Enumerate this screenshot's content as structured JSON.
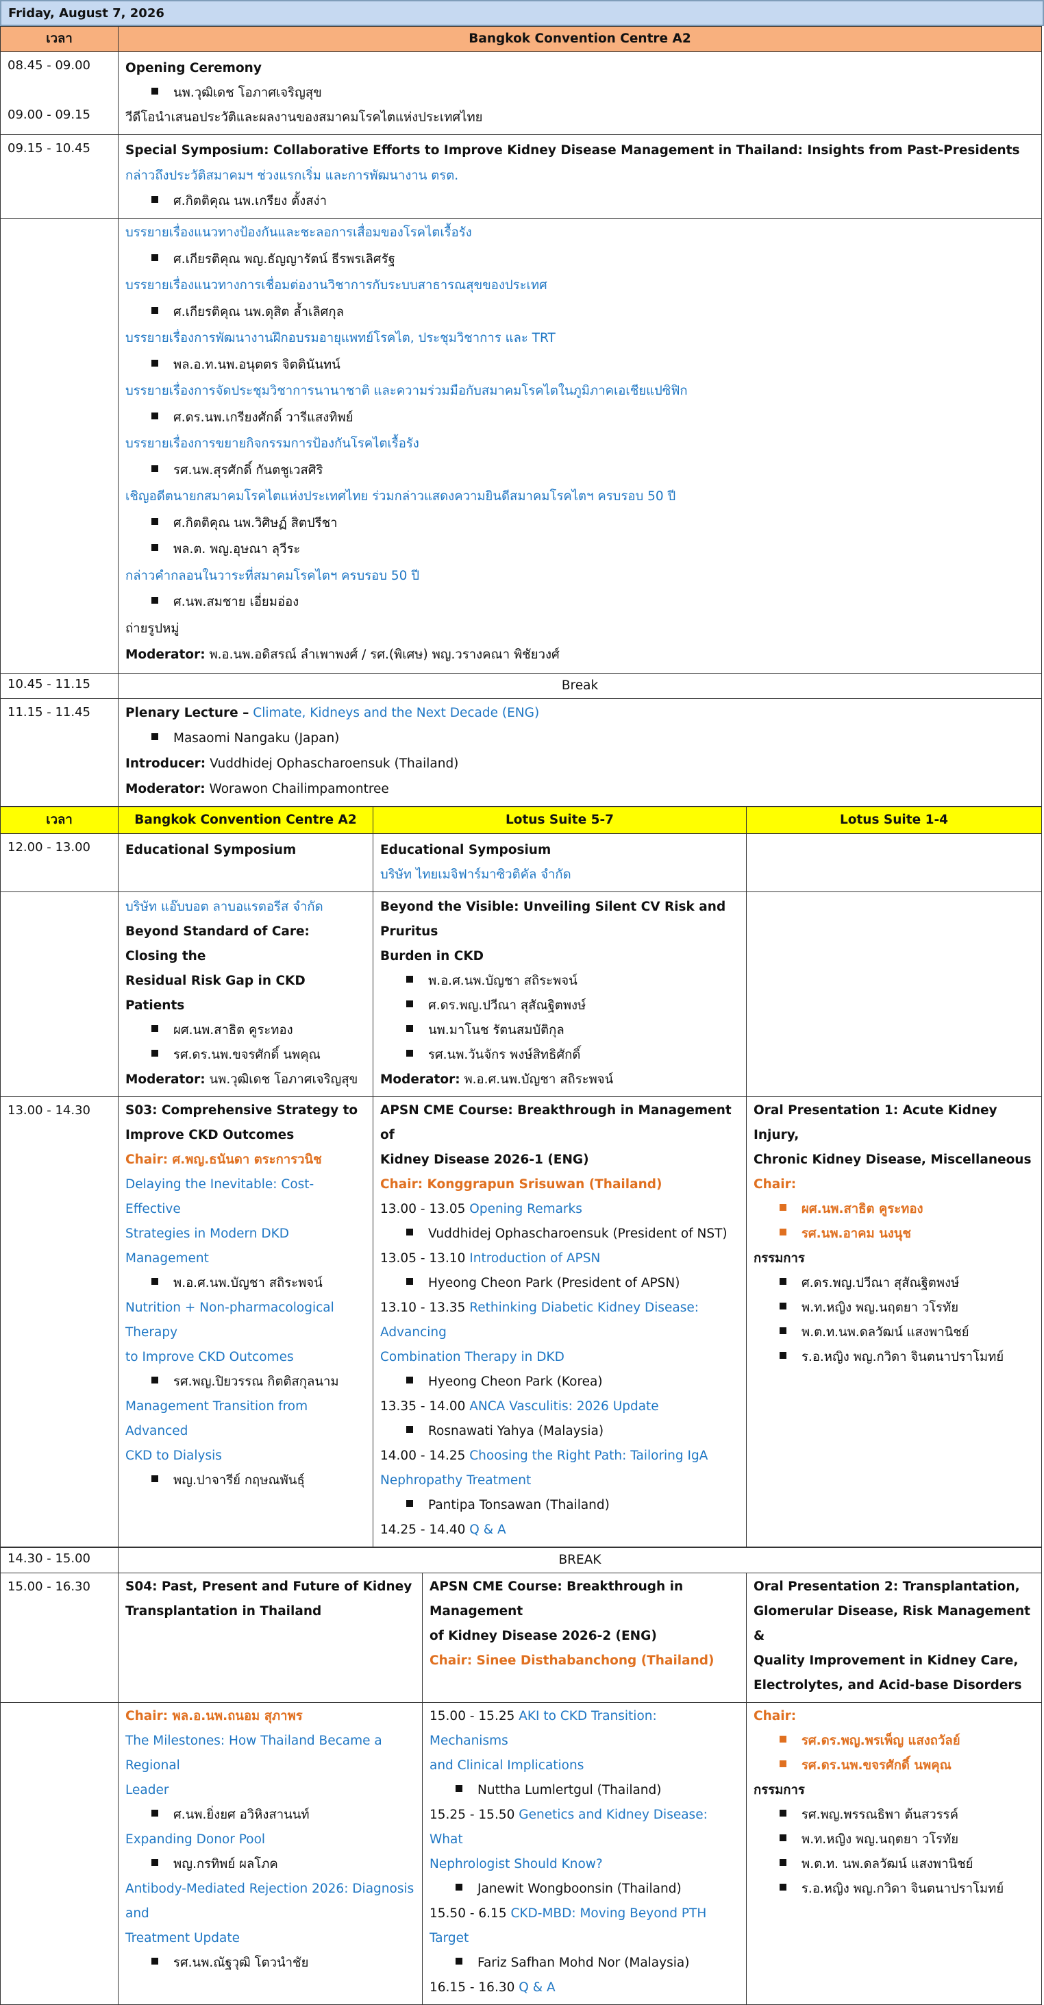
{
  "date": "Friday, August 7, 2026",
  "labels": {
    "time_col": "เวลา",
    "room_a2": "Bangkok Convention Centre A2",
    "room_lotus57": "Lotus Suite 5-7",
    "room_lotus14": "Lotus Suite 1-4",
    "moderator": "Moderator:",
    "introducer": "Introducer:",
    "chair": "Chair:",
    "committee": "กรรมการ"
  },
  "s1": {
    "time1": "08.45 - 09.00",
    "time2": "09.00 - 09.15",
    "title": "Opening Ceremony",
    "person": "นพ.วุฒิเดช โอภาศเจริญสุข",
    "video": "วีดีโอนำเสนอประวัติและผลงานของสมาคมโรคไตแห่งประเทศไทย"
  },
  "s2": {
    "time": "09.15 - 10.45",
    "title": "Special Symposium: Collaborative Efforts to Improve Kidney Disease Management in Thailand: Insights from Past-Presidents",
    "t1": "กล่าวถึงประวัติสมาคมฯ ช่วงแรกเริ่ม และการพัฒนางาน ตรต.",
    "p1": "ศ.กิตติคุณ นพ.เกรียง ตั้งสง่า",
    "t2": "บรรยายเรื่องแนวทางป้องกันและชะลอการเสื่อมของโรคไตเรื้อรัง",
    "p2": "ศ.เกียรติคุณ พญ.ธัญญารัตน์ ธีรพรเลิศรัฐ",
    "t3": "บรรยายเรื่องแนวทางการเชื่อมต่องานวิชาการกับระบบสาธารณสุขของประเทศ",
    "p3": "ศ.เกียรติคุณ นพ.ดุสิต ล้ำเลิศกุล",
    "t4": "บรรยายเรื่องการพัฒนางานฝึกอบรมอายุแพทย์โรคไต, ประชุมวิชาการ และ TRT",
    "p4": "พล.อ.ท.นพ.อนุตตร จิตตินันทน์",
    "t5": "บรรยายเรื่องการจัดประชุมวิชาการนานาชาติ และความร่วมมือกับสมาคมโรคไตในภูมิภาคเอเชียแปซิฟิก",
    "p5": "ศ.ดร.นพ.เกรียงศักดิ์ วารีแสงทิพย์",
    "t6": "บรรยายเรื่องการขยายกิจกรรมการป้องกันโรคไตเรื้อรัง",
    "p6": "รศ.นพ.สุรศักดิ์ กันตชูเวสศิริ",
    "t7": "เชิญอดีตนายกสมาคมโรคไตแห่งประเทศไทย ร่วมกล่าวแสดงความยินดีสมาคมโรคไตฯ ครบรอบ 50 ปี",
    "p7a": "ศ.กิตติคุณ นพ.วิศิษฏ์ สิตปรีชา",
    "p7b": "พล.ต. พญ.อุษณา ลุวีระ",
    "t8": "กล่าวคำกลอนในวาระที่สมาคมโรคไตฯ ครบรอบ 50 ปี",
    "p8": "ศ.นพ.สมชาย เอี่ยมอ่อง",
    "photo": "ถ่ายรูปหมู่",
    "moderator": "พ.อ.นพ.อดิสรณ์ ลำเพาพงศ์ / รศ.(พิเศษ) พญ.วรางคณา พิชัยวงศ์"
  },
  "break1": {
    "time": "10.45 - 11.15",
    "label": "Break"
  },
  "s3": {
    "time": "11.15 - 11.45",
    "prefix": "Plenary Lecture –",
    "title": "Climate, Kidneys and the Next Decade (ENG)",
    "speaker": "Masaomi Nangaku (Japan)",
    "introducer": "Vuddhidej Ophascharoensuk (Thailand)",
    "moderator": "Worawon Chailimpamontree"
  },
  "s4": {
    "time": "12.00 - 13.00",
    "a2": {
      "title": "Educational Symposium",
      "sponsor": "บริษัท แอ๊บบอต ลาบอแรตอรีส จำกัด",
      "talk1": "Beyond Standard of Care: Closing the",
      "talk2": "Residual Risk Gap in CKD Patients",
      "p1": "ผศ.นพ.สาธิต คูระทอง",
      "p2": "รศ.ดร.นพ.ขจรศักดิ์ นพคุณ",
      "moderator": "นพ.วุฒิเดช โอภาศเจริญสุข"
    },
    "lotus": {
      "title": "Educational Symposium",
      "sponsor": "บริษัท ไทยเมจิฟาร์มาซิวติคัล จำกัด",
      "talk1": "Beyond the Visible: Unveiling Silent CV Risk and Pruritus",
      "talk2": "Burden in CKD",
      "p1": "พ.อ.ศ.นพ.บัญชา สถิระพจน์",
      "p2": "ศ.ดร.พญ.ปวีณา สุสัณฐิตพงษ์",
      "p3": "นพ.มาโนช รัตนสมบัติกุล",
      "p4": "รศ.นพ.วันจักร พงษ์สิทธิศักดิ์",
      "moderator": "พ.อ.ศ.นพ.บัญชา สถิระพจน์"
    }
  },
  "s5": {
    "time": "13.00 - 14.30",
    "a2": {
      "title1": "S03: Comprehensive Strategy to",
      "title2": "Improve CKD Outcomes",
      "chair": "Chair: ศ.พญ.ธนันดา ตระการวนิช",
      "t1a": "Delaying the Inevitable: Cost-Effective",
      "t1b": "Strategies in Modern DKD Management",
      "p1": "พ.อ.ศ.นพ.บัญชา สถิระพจน์",
      "t2a": "Nutrition + Non-pharmacological Therapy",
      "t2b": "to Improve CKD Outcomes",
      "p2": "รศ.พญ.ปิยวรรณ กิตติสกุลนาม",
      "t3a": "Management Transition from Advanced",
      "t3b": "CKD to Dialysis",
      "p3": "พญ.ปาจารีย์ กฤษณพันธุ์"
    },
    "lotus": {
      "title1": "APSN CME Course: Breakthrough in Management of",
      "title2": "Kidney Disease 2026-1 (ENG)",
      "chair": "Chair:  Konggrapun Srisuwan (Thailand)",
      "i1t": "13.00 - 13.05",
      "i1": "Opening Remarks",
      "i1p": "Vuddhidej Ophascharoensuk (President of NST)",
      "i2t": "13.05 - 13.10",
      "i2": "Introduction of APSN",
      "i2p": "Hyeong Cheon Park (President of APSN)",
      "i3t": "13.10 - 13.35",
      "i3a": "Rethinking Diabetic Kidney Disease: Advancing",
      "i3b": "Combination Therapy in DKD",
      "i3p": "Hyeong Cheon Park (Korea)",
      "i4t": "13.35 - 14.00",
      "i4": "ANCA Vasculitis: 2026 Update",
      "i4p": "Rosnawati Yahya (Malaysia)",
      "i5t": "14.00 - 14.25",
      "i5a": "Choosing the Right Path: Tailoring IgA",
      "i5b": "Nephropathy Treatment",
      "i5p": "Pantipa Tonsawan (Thailand)",
      "i6t": "14.25 - 14.40",
      "i6": "Q & A"
    },
    "lotus14": {
      "title1": "Oral Presentation 1: Acute Kidney Injury,",
      "title2": "Chronic Kidney Disease, Miscellaneous",
      "chair": "Chair:",
      "c1": "ผศ.นพ.สาธิต คูระทอง",
      "c2": "รศ.นพ.อาคม นงนุช",
      "m1": "ศ.ดร.พญ.ปวีณา สุสัณฐิตพงษ์",
      "m2": "พ.ท.หญิง พญ.นฤตยา วโรทัย",
      "m3": "พ.ต.ท.นพ.ดลวัฒน์ แสงพานิชย์",
      "m4": "ร.อ.หญิง พญ.กวิดา จินตนาปราโมทย์"
    }
  },
  "break2": {
    "time": "14.30 - 15.00",
    "label": "BREAK"
  },
  "s6": {
    "time": "15.00 - 16.30",
    "a2": {
      "title1": "S04: Past, Present and Future of Kidney",
      "title2": "Transplantation in Thailand",
      "chair": "Chair: พล.อ.นพ.ถนอม สุภาพร",
      "t1a": "The Milestones: How Thailand Became a Regional",
      "t1b": "Leader",
      "p1": "ศ.นพ.ยิ่งยศ อวิหิงสานนท์",
      "t2": "Expanding Donor Pool",
      "p2": "พญ.กรทิพย์ ผลโภค",
      "t3a": "Antibody-Mediated Rejection 2026: Diagnosis and",
      "t3b": "Treatment Update",
      "p3": "รศ.นพ.ณัฐวุฒิ โตวนำชัย"
    },
    "lotus": {
      "title1": "APSN CME Course: Breakthrough in Management",
      "title2": "of Kidney Disease 2026-2 (ENG)",
      "chair": "Chair: Sinee Disthabanchong (Thailand)",
      "i1t": "15.00 - 15.25",
      "i1a": "AKI to CKD Transition: Mechanisms",
      "i1b": "and Clinical Implications",
      "i1p": "Nuttha Lumlertgul (Thailand)",
      "i2t": "15.25 - 15.50",
      "i2a": "Genetics and Kidney Disease: What",
      "i2b": "Nephrologist Should Know?",
      "i2p": "Janewit Wongboonsin (Thailand)",
      "i3t": "15.50 - 6.15",
      "i3": "CKD-MBD: Moving Beyond PTH Target",
      "i3p": "Fariz Safhan Mohd Nor (Malaysia)",
      "i4t": "16.15 - 16.30",
      "i4": "Q & A"
    },
    "lotus14": {
      "title1": "Oral Presentation 2: Transplantation,",
      "title2": "Glomerular Disease, Risk Management &",
      "title3": "Quality Improvement in Kidney Care,",
      "title4": "Electrolytes, and Acid-base Disorders",
      "chair": "Chair:",
      "c1": "รศ.ดร.พญ.พรเพ็ญ แสงถวัลย์",
      "c2": "รศ.ดร.นพ.ขจรศักดิ์ นพคุณ",
      "m1": "รศ.พญ.พรรณธิพา ต้นสวรรค์",
      "m2": "พ.ท.หญิง พญ.นฤตยา วโรทัย",
      "m3": "พ.ต.ท. นพ.ดลวัฒน์ แสงพานิชย์",
      "m4": "ร.อ.หญิง พญ.กวิดา จินตนาปราโมทย์"
    }
  }
}
